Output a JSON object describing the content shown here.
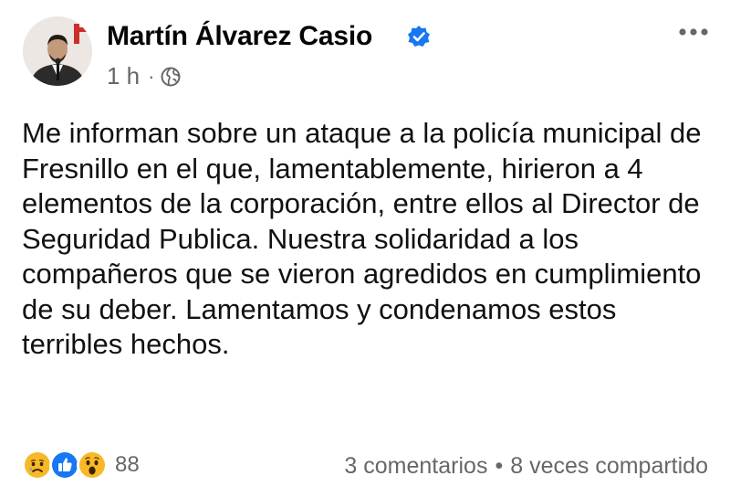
{
  "post": {
    "author_name": "Martín Álvarez Casio",
    "time": "1 h",
    "separator": "·",
    "privacy_icon": "globe-icon",
    "verified_icon": "verified-badge-icon",
    "more_icon": "more-options-icon",
    "text": "Me informan sobre un ataque a la policía municipal de Fresnillo en el que, lamentablemente, hirieron a 4 elementos de la corporación, entre ellos al Director de Seguridad Publica. Nuestra solidaridad a los compañeros que se vieron agredidos en cumplimiento de su deber. Lamentamos y condenamos estos terribles hechos."
  },
  "footer": {
    "reactions": [
      "sad-reaction-icon",
      "like-reaction-icon",
      "wow-reaction-icon"
    ],
    "reaction_count": "88",
    "comments": "3 comentarios",
    "separator": "•",
    "shares": "8 veces compartido"
  },
  "colors": {
    "link_blue": "#1877f2",
    "secondary_text": "#65676b",
    "reaction_yellow": "#f7b928"
  }
}
